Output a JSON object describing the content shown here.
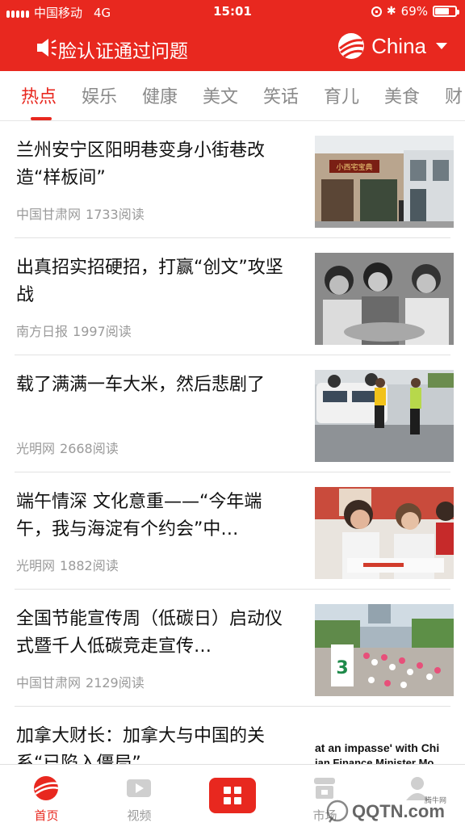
{
  "status_bar": {
    "carrier": "中国移动",
    "network": "4G",
    "time": "15:01",
    "battery": "69%",
    "battery_level": 0.69
  },
  "header": {
    "marquee": "脸认证通过问题",
    "brand": "China"
  },
  "tabs": [
    "热点",
    "娱乐",
    "健康",
    "美文",
    "笑话",
    "育儿",
    "美食",
    "财"
  ],
  "active_tab": 0,
  "feed": [
    {
      "title": "兰州安宁区阳明巷变身小街巷改造“样板间”",
      "source": "中国甘肃网",
      "reads": "1733阅读",
      "thumb_sign": "小西宅宝典"
    },
    {
      "title": "出真招实招硬招，打赢“创文”攻坚战",
      "source": "南方日报",
      "reads": "1997阅读"
    },
    {
      "title": "载了满满一车大米，然后悲剧了",
      "source": "光明网",
      "reads": "2668阅读"
    },
    {
      "title": "端午情深 文化意重——“今年端午，我与海淀有个约会”中…",
      "source": "光明网",
      "reads": "1882阅读"
    },
    {
      "title": "全国节能宣传周（低碳日）启动仪式暨千人低碳竞走宣传…",
      "source": "中国甘肃网",
      "reads": "2129阅读",
      "thumb_sign": "3"
    },
    {
      "title": "加拿大财长：加拿大与中国的关系“已陷入僵局”",
      "source": "",
      "reads": "",
      "thumb_text": "at an impasse' with Chi",
      "thumb_text2": "ian Finance Minister Mo"
    }
  ],
  "bottom_nav": [
    {
      "label": "首页",
      "icon": "home-globe-icon"
    },
    {
      "label": "视频",
      "icon": "video-icon"
    },
    {
      "label": "",
      "icon": "apps-grid-icon"
    },
    {
      "label": "市场",
      "icon": "market-icon"
    },
    {
      "label": "",
      "icon": "user-icon"
    }
  ],
  "watermark": {
    "text": "QQTN.com",
    "small": "腾牛网"
  },
  "colors": {
    "brand_red": "#e8281f",
    "muted": "#9a9a9a",
    "divider": "#e2e2e2"
  }
}
